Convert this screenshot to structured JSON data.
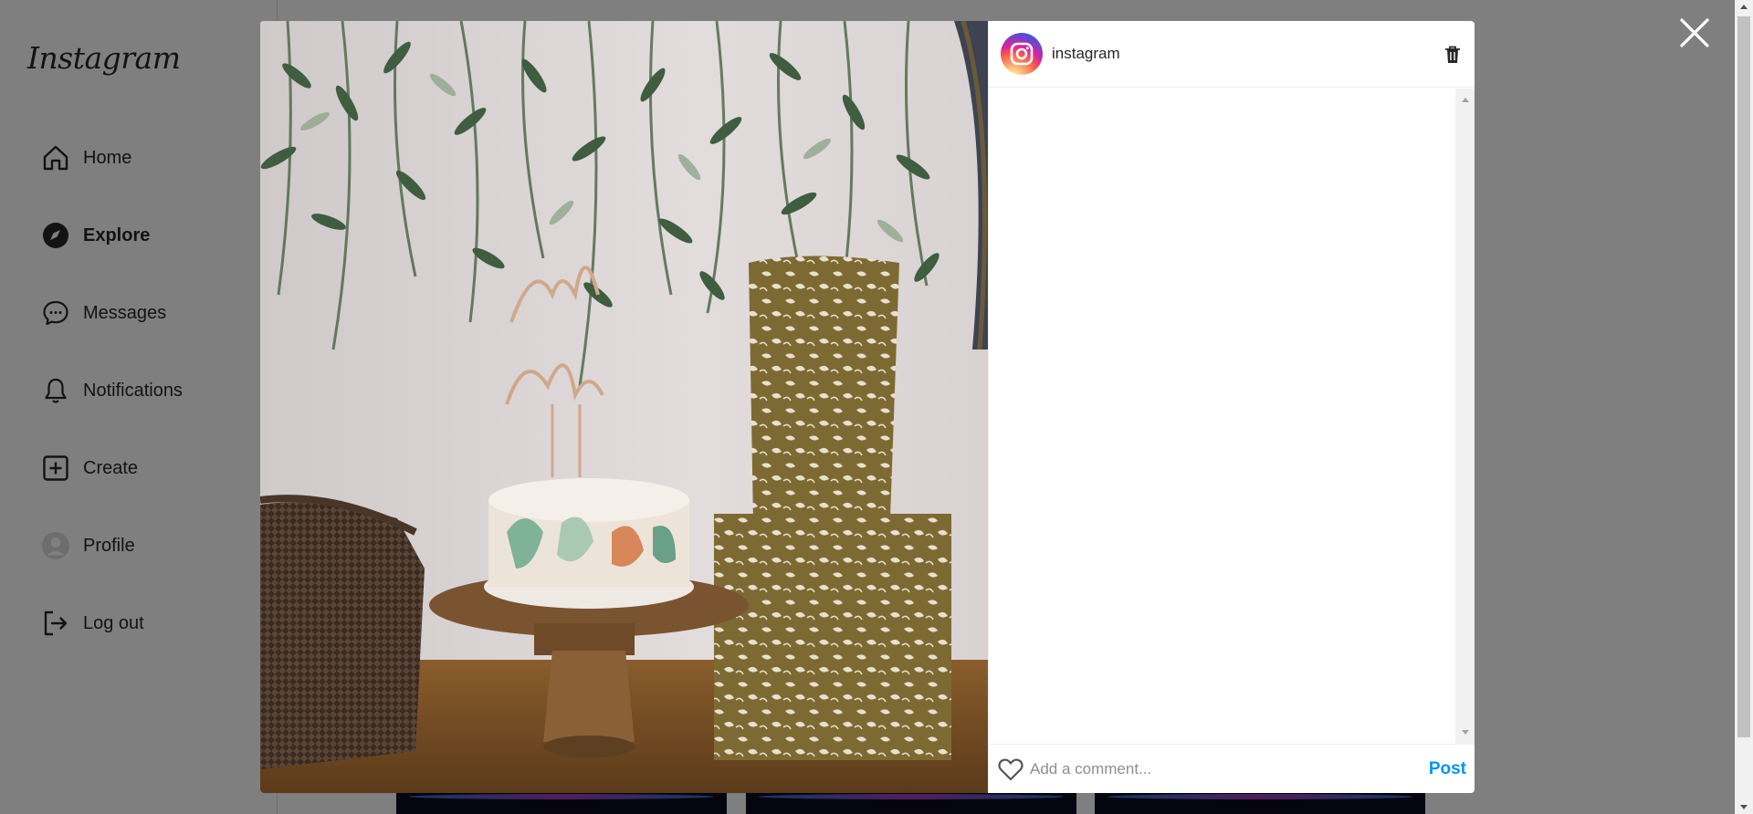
{
  "sidebar": {
    "logo": "Instagram",
    "items": [
      {
        "label": "Home",
        "icon": "home-icon"
      },
      {
        "label": "Explore",
        "icon": "compass-icon",
        "active": true
      },
      {
        "label": "Messages",
        "icon": "chat-icon"
      },
      {
        "label": "Notifications",
        "icon": "bell-icon"
      },
      {
        "label": "Create",
        "icon": "plus-square-icon"
      },
      {
        "label": "Profile",
        "icon": "avatar-icon"
      },
      {
        "label": "Log out",
        "icon": "logout-icon"
      }
    ]
  },
  "modal": {
    "image": {
      "description_icon": "post-photo"
    },
    "header": {
      "username": "instagram",
      "avatar_icon": "instagram-logo-icon",
      "delete_icon": "trash-icon"
    },
    "comment_bar": {
      "placeholder": "Add a comment...",
      "post_label": "Post",
      "like_icon": "heart-icon"
    }
  },
  "colors": {
    "accent": "#0095f6",
    "overlay": "rgba(0,0,0,0.5)",
    "text": "#262626",
    "muted": "#8e8e8e"
  }
}
